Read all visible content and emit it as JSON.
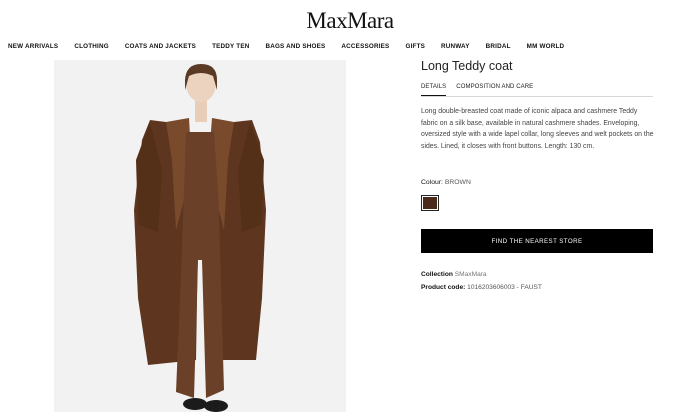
{
  "brand": {
    "logo": "MaxMara"
  },
  "nav": {
    "items": [
      "NEW ARRIVALS",
      "CLOTHING",
      "COATS AND JACKETS",
      "TEDDY TEN",
      "BAGS AND SHOES",
      "ACCESSORIES",
      "GIFTS",
      "RUNWAY",
      "BRIDAL",
      "MM WORLD"
    ]
  },
  "product": {
    "title": "Long Teddy coat",
    "tabs": {
      "details": "DETAILS",
      "composition": "COMPOSITION AND CARE"
    },
    "description": "Long double-breasted coat made of iconic alpaca and cashmere Teddy fabric on a silk base, available in natural cashmere shades. Enveloping, oversized style with a wide lapel collar, long sleeves and welt pockets on the sides. Lined, it closes with front buttons. Length: 130 cm.",
    "colour_label": "Colour:",
    "colour_value": "BROWN",
    "swatch_color": "#4a2a1c",
    "store_button": "FIND THE NEAREST STORE",
    "collection_label": "Collection",
    "collection_value": "SMaxMara",
    "product_code_label": "Product code:",
    "product_code_value": "1016203606003 - FAUST"
  },
  "colors": {
    "accent": "#000000",
    "coat": "#6b3f24",
    "background": "#f2f2f2"
  }
}
